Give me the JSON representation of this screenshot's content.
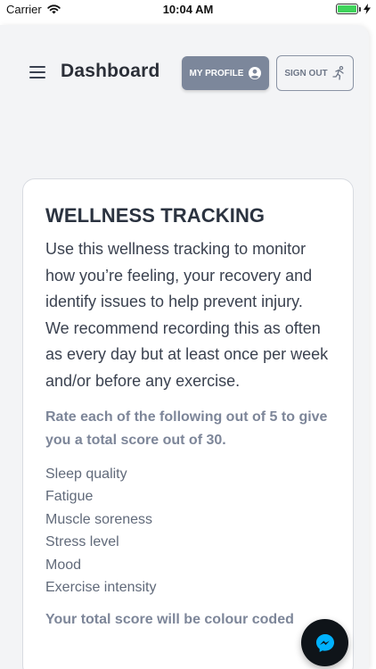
{
  "status_bar": {
    "carrier": "Carrier",
    "time": "10:04 AM",
    "battery_level": 1.0
  },
  "header": {
    "title": "Dashboard",
    "profile_button": "MY PROFILE",
    "signout_button": "SIGN OUT"
  },
  "card": {
    "title": "WELLNESS TRACKING",
    "paragraph_1": "Use this wellness tracking to monitor how you’re feeling, your recovery and identify issues to help prevent injury.",
    "paragraph_2": "We recommend recording this as often as every day but at least once per week and/or before any exercise.",
    "instruction": "Rate each of the following out of 5 to give you a total score out of 30.",
    "metrics": [
      "Sleep quality",
      "Fatigue",
      "Muscle soreness",
      "Stress level",
      "Mood",
      "Exercise intensity"
    ],
    "footer_partial": "Your total score will be colour coded"
  },
  "colors": {
    "app_bg": "#f3f4f6",
    "profile_button_bg": "#7c879b",
    "signout_border": "#8a93a4",
    "text_dark": "#2b3340",
    "text_muted": "#7d8699",
    "fab_bg": "#0f1419",
    "messenger_blue": "#00b2ff"
  },
  "icons": {
    "menu": "hamburger-icon",
    "profile": "user-circle-icon",
    "signout": "running-person-icon",
    "chat": "messenger-icon"
  }
}
